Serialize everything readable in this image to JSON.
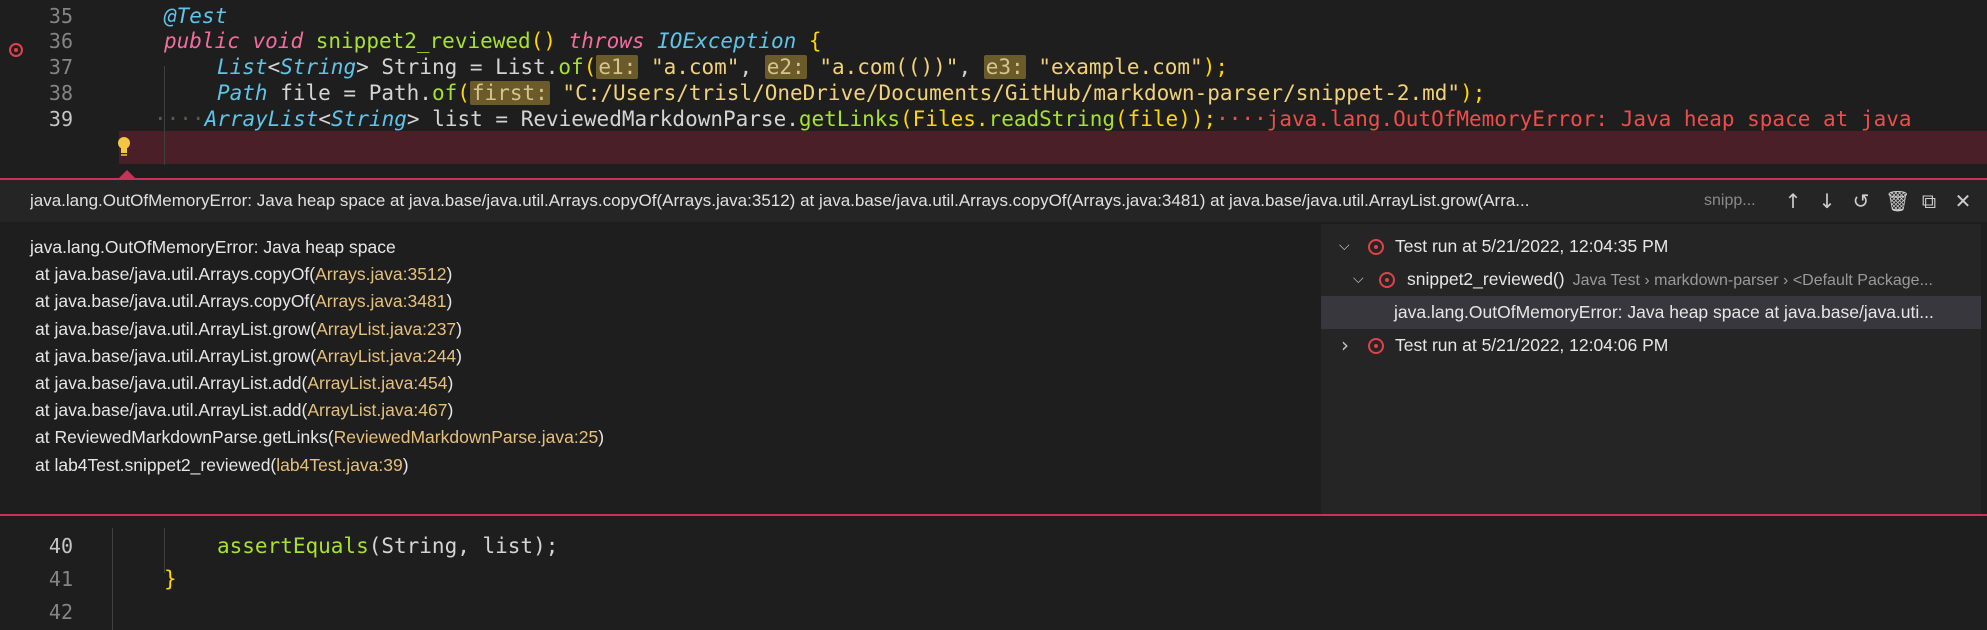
{
  "editor": {
    "lines": [
      {
        "num": "35"
      },
      {
        "num": "36"
      },
      {
        "num": "37"
      },
      {
        "num": "38"
      },
      {
        "num": "39"
      },
      {
        "num": "40"
      },
      {
        "num": "41"
      },
      {
        "num": "42"
      }
    ],
    "l35": {
      "annotation": "@Test"
    },
    "l36": {
      "kw_public": "public",
      "kw_void": "void",
      "method": "snippet2_reviewed",
      "paren": "()",
      "kw_throws": "throws",
      "type": "IOException",
      "brace": "{"
    },
    "l37": {
      "type_list": "List",
      "lt": "<",
      "type_string": "String",
      "gt": ">",
      "var": " String = List.",
      "fn_of": "of",
      "open": "(",
      "hint_e1": "e1:",
      "s1": "\"a.com\"",
      "comma1": ", ",
      "hint_e2": "e2:",
      "s2": "\"a.com(())\"",
      "comma2": ", ",
      "hint_e3": "e3:",
      "s3": "\"example.com\"",
      "close": ");"
    },
    "l38": {
      "type_path": "Path",
      "var": " file = Path.",
      "fn_of": "of",
      "open": "(",
      "hint_first": "first:",
      "s1": "\"C:/Users/trisl/OneDrive/Documents/GitHub/markdown-parser/snippet-2.md\"",
      "close": ");"
    },
    "l39": {
      "dots": "····",
      "type_arraylist": "ArrayList",
      "lt": "<",
      "type_string": "String",
      "gt": ">",
      "mid": " list = ",
      "cls": "ReviewedMarkdownParse",
      "dot": ".",
      "fn_getlinks": "getLinks",
      "open": "(Files.",
      "fn_readstring": "readString",
      "close": "(file));",
      "inline_error": "····java.lang.OutOfMemoryError: Java heap space at java"
    },
    "l40": {
      "fn": "assertEquals",
      "args": "(String, list);"
    },
    "l41": {
      "brace": "}"
    }
  },
  "peek": {
    "title": "java.lang.OutOfMemoryError: Java heap space at java.base/java.util.Arrays.copyOf(Arrays.java:3512) at java.base/java.util.Arrays.copyOf(Arrays.java:3481) at java.base/java.util.ArrayList.grow(Arra...",
    "subtitle": "snipp...",
    "actions": {
      "up": "↑",
      "down": "↓",
      "history": "↺",
      "trash": "🗑",
      "open": "⧉",
      "close": "✕"
    },
    "trace": {
      "message": "java.lang.OutOfMemoryError: Java heap space",
      "frames": [
        {
          "pre": "at java.base/java.util.Arrays.copyOf(",
          "loc": "Arrays.java:3512",
          "post": ")"
        },
        {
          "pre": "at java.base/java.util.Arrays.copyOf(",
          "loc": "Arrays.java:3481",
          "post": ")"
        },
        {
          "pre": "at java.base/java.util.ArrayList.grow(",
          "loc": "ArrayList.java:237",
          "post": ")"
        },
        {
          "pre": "at java.base/java.util.ArrayList.grow(",
          "loc": "ArrayList.java:244",
          "post": ")"
        },
        {
          "pre": "at java.base/java.util.ArrayList.add(",
          "loc": "ArrayList.java:454",
          "post": ")"
        },
        {
          "pre": "at java.base/java.util.ArrayList.add(",
          "loc": "ArrayList.java:467",
          "post": ")"
        },
        {
          "pre": "at ReviewedMarkdownParse.getLinks(",
          "loc": "ReviewedMarkdownParse.java:25",
          "post": ")"
        },
        {
          "pre": "at lab4Test.snippet2_reviewed(",
          "loc": "lab4Test.java:39",
          "post": ")"
        }
      ]
    },
    "results": {
      "run1": {
        "chevron": "⌵",
        "label": "Test run at 5/21/2022, 12:04:35 PM"
      },
      "test1": {
        "chevron": "⌵",
        "label": "snippet2_reviewed()",
        "desc": "Java Test › markdown-parser › <Default Package..."
      },
      "message": "java.lang.OutOfMemoryError: Java heap space at java.base/java.uti...",
      "run2": {
        "chevron": "›",
        "label": "Test run at 5/21/2022, 12:04:06 PM"
      }
    }
  },
  "colors": {
    "error": "#e0424a",
    "border": "#c8325a",
    "link": "#e5c07b"
  }
}
